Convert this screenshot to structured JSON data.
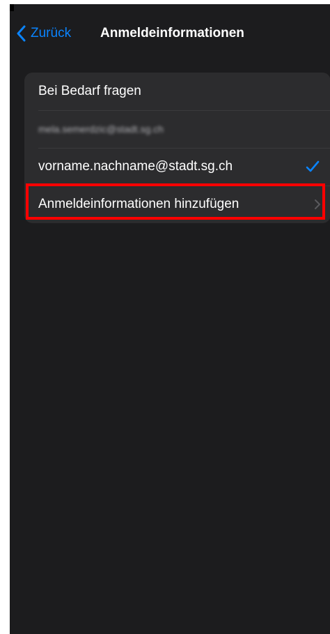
{
  "nav": {
    "back_label": "Zurück",
    "title": "Anmeldeinformationen"
  },
  "list": {
    "items": [
      {
        "label": "Bei Bedarf fragen",
        "selected": false,
        "blurred": false
      },
      {
        "label": "mela.semerdzic@stadt.sg.ch",
        "selected": false,
        "blurred": true
      },
      {
        "label": "vorname.nachname@stadt.sg.ch",
        "selected": true,
        "blurred": false
      },
      {
        "label": "Anmeldeinformationen hinzufügen",
        "selected": false,
        "blurred": false,
        "has_chevron": true
      }
    ]
  },
  "icons": {
    "back": "chevron-left-icon",
    "selected": "checkmark-icon",
    "disclosure": "chevron-right-icon"
  },
  "colors": {
    "background": "#1c1c1e",
    "card": "#2c2c2e",
    "accent": "#0a84ff",
    "highlight": "#ff0000"
  }
}
